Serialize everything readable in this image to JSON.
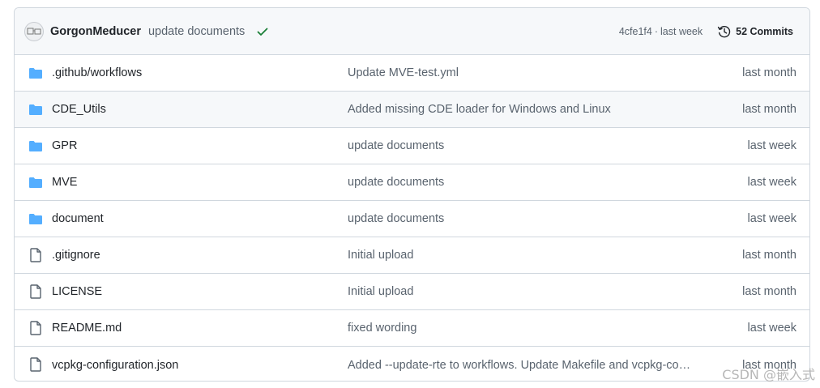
{
  "commit": {
    "author": "GorgonMeducer",
    "message": "update documents",
    "sha": "4cfe1f4",
    "separator": "·",
    "date": "last week",
    "commits_label": "52 Commits",
    "status_color": "#1a7f37"
  },
  "colors": {
    "folder": "#54aeff",
    "file": "#59636e",
    "border": "#d0d7de",
    "header_bg": "#f6f8fa"
  },
  "files": [
    {
      "type": "folder",
      "name": ".github/workflows",
      "message": "Update MVE-test.yml",
      "time": "last month"
    },
    {
      "type": "folder",
      "name": "CDE_Utils",
      "message": "Added missing CDE loader for Windows and Linux",
      "time": "last month"
    },
    {
      "type": "folder",
      "name": "GPR",
      "message": "update documents",
      "time": "last week"
    },
    {
      "type": "folder",
      "name": "MVE",
      "message": "update documents",
      "time": "last week"
    },
    {
      "type": "folder",
      "name": "document",
      "message": "update documents",
      "time": "last week"
    },
    {
      "type": "file",
      "name": ".gitignore",
      "message": "Initial upload",
      "time": "last month"
    },
    {
      "type": "file",
      "name": "LICENSE",
      "message": "Initial upload",
      "time": "last month"
    },
    {
      "type": "file",
      "name": "README.md",
      "message": "fixed wording",
      "time": "last week"
    },
    {
      "type": "file",
      "name": "vcpkg-configuration.json",
      "message": "Added --update-rte to workflows. Update Makefile and vcpkg-configuration.json",
      "time": "last month"
    }
  ],
  "watermark": "CSDN @嵌入式"
}
